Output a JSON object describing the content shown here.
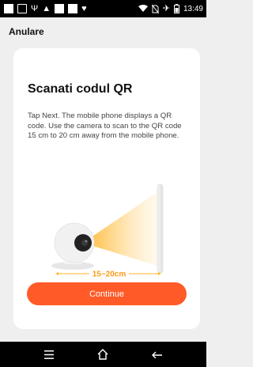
{
  "status_bar": {
    "time": "13:49",
    "left_icons": [
      "notification-square-icon",
      "image-icon",
      "usb-icon",
      "warning-icon",
      "square-icon",
      "square-icon",
      "shield-icon"
    ],
    "right_icons": [
      "wifi-icon",
      "no-sim-icon",
      "airplane-mode-icon",
      "battery-icon"
    ]
  },
  "header": {
    "cancel_label": "Anulare"
  },
  "card": {
    "title": "Scanati codul QR",
    "description": "Tap Next. The mobile phone displays a QR code. Use the camera to scan to the QR code 15 cm to 20 cm away from the mobile phone.",
    "distance_label": "15~20cm",
    "button_label": "Continue"
  },
  "nav_bar": {
    "icons": [
      "menu-icon",
      "home-icon",
      "back-icon"
    ]
  },
  "colors": {
    "accent": "#ff5a28",
    "beam": "#ffc24a"
  }
}
